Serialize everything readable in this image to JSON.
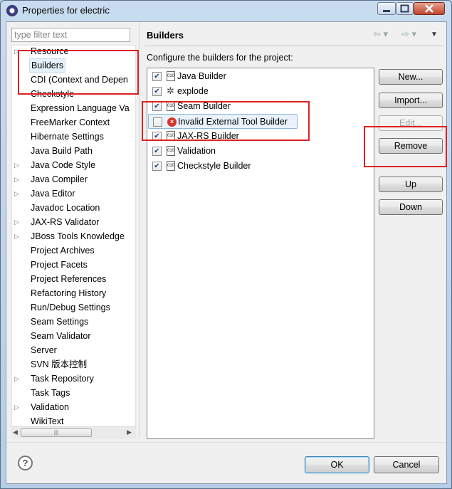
{
  "window": {
    "title": "Properties for electric",
    "controls": [
      "▭",
      "▢",
      "✕"
    ]
  },
  "left": {
    "filter_placeholder": "type filter text",
    "tree": [
      {
        "label": "Resource",
        "expandable": true
      },
      {
        "label": "Builders",
        "selected": true
      },
      {
        "label": "CDI (Context and Depen"
      },
      {
        "label": "Checkstyle"
      },
      {
        "label": "Expression Language Va"
      },
      {
        "label": "FreeMarker Context"
      },
      {
        "label": "Hibernate Settings"
      },
      {
        "label": "Java Build Path"
      },
      {
        "label": "Java Code Style",
        "expandable": true
      },
      {
        "label": "Java Compiler",
        "expandable": true
      },
      {
        "label": "Java Editor",
        "expandable": true
      },
      {
        "label": "Javadoc Location"
      },
      {
        "label": "JAX-RS Validator",
        "expandable": true
      },
      {
        "label": "JBoss Tools Knowledge",
        "expandable": true
      },
      {
        "label": "Project Archives"
      },
      {
        "label": "Project Facets"
      },
      {
        "label": "Project References"
      },
      {
        "label": "Refactoring History"
      },
      {
        "label": "Run/Debug Settings"
      },
      {
        "label": "Seam Settings"
      },
      {
        "label": "Seam Validator"
      },
      {
        "label": "Server"
      },
      {
        "label": "SVN 版本控制"
      },
      {
        "label": "Task Repository",
        "expandable": true
      },
      {
        "label": "Task Tags"
      },
      {
        "label": "Validation",
        "expandable": true
      },
      {
        "label": "WikiText"
      }
    ],
    "scroll_left": "◀",
    "scroll_right": "▶",
    "scroll_grip": "|||"
  },
  "page": {
    "title": "Builders",
    "nav_back": "⇦ ▾",
    "nav_forward": "⇨ ▾",
    "nav_menu": "▼",
    "description": "Configure the builders for the project:",
    "builders": [
      {
        "label": "Java Builder",
        "checked": true,
        "icon": "file-icon"
      },
      {
        "label": "explode",
        "checked": true,
        "icon": "bug-icon"
      },
      {
        "label": "Seam Builder",
        "checked": true,
        "icon": "file-icon"
      },
      {
        "label": "Invalid External Tool Builder",
        "checked": false,
        "icon": "error-icon",
        "selected": true
      },
      {
        "label": "JAX-RS Builder",
        "checked": true,
        "icon": "file-icon"
      },
      {
        "label": "Validation",
        "checked": true,
        "icon": "file-icon"
      },
      {
        "label": "Checkstyle Builder",
        "checked": true,
        "icon": "file-icon"
      }
    ],
    "buttons": {
      "new": "New...",
      "import": "Import...",
      "edit": "Edit...",
      "remove": "Remove",
      "up": "Up",
      "down": "Down"
    }
  },
  "footer": {
    "help": "?",
    "ok": "OK",
    "cancel": "Cancel"
  },
  "colors": {
    "annotation": "#e02020",
    "selection": "#e5f1fb"
  }
}
